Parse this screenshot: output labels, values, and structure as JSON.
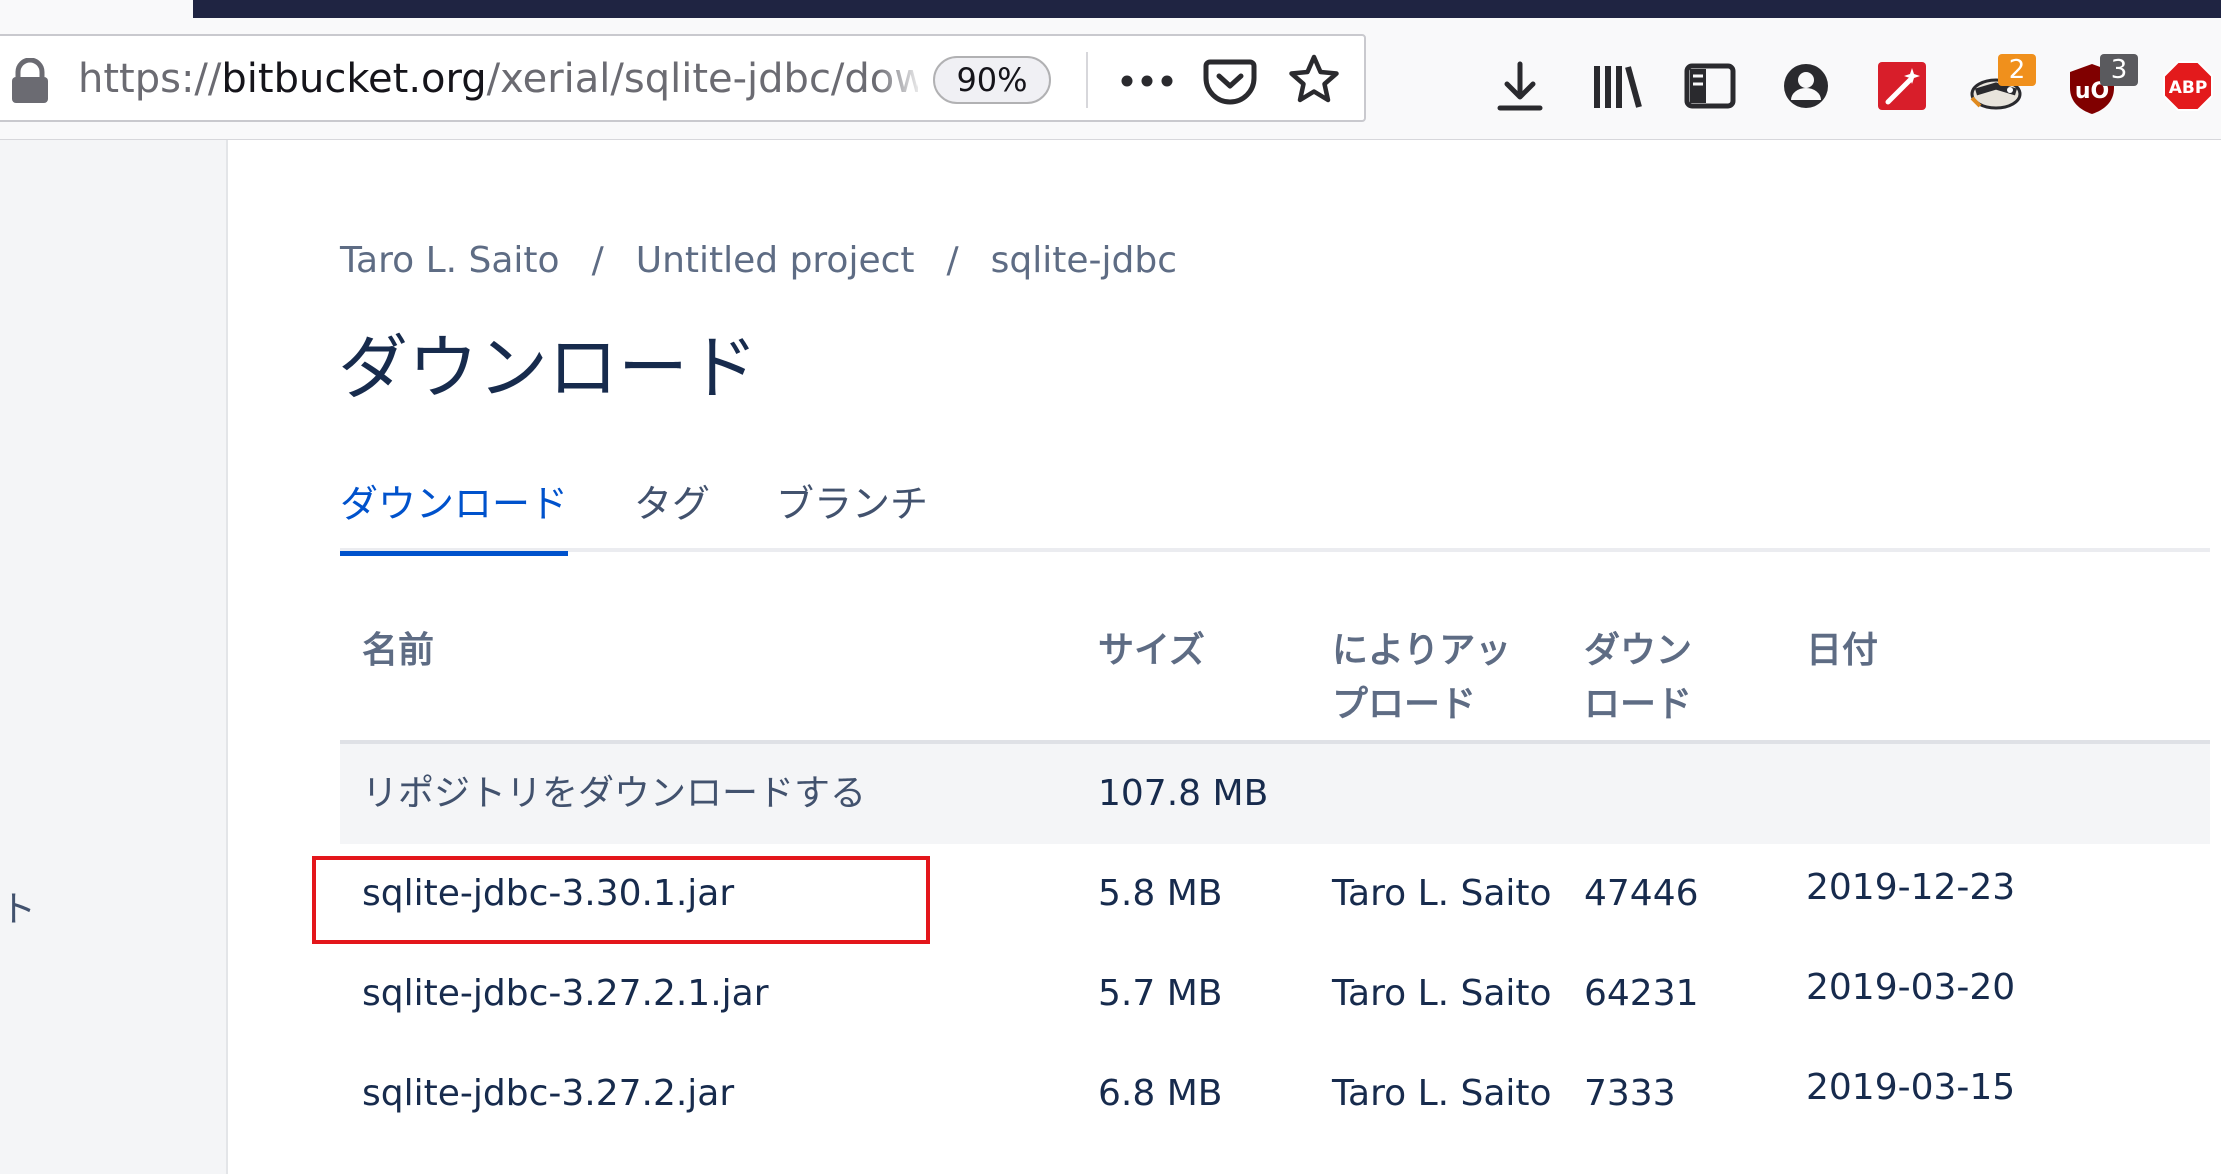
{
  "browser": {
    "url_prefix": "https://",
    "url_host": "bitbucket.org",
    "url_path": "/xerial/sqlite-jdbc/downl",
    "zoom": "90%",
    "extensions": {
      "redirector_badge": "2",
      "ublock_badge": "3",
      "adblock_label": "ABP"
    },
    "colors": {
      "chrome_dark": "#1f2442",
      "toolbar": "#f9f9fa"
    }
  },
  "sidebar": {
    "fragment": "ト"
  },
  "breadcrumb": [
    "Taro L. Saito",
    "Untitled project",
    "sqlite-jdbc"
  ],
  "breadcrumb_sep": "/",
  "page": {
    "title": "ダウンロード"
  },
  "tabs": [
    {
      "label": "ダウンロード",
      "active": true
    },
    {
      "label": "タグ",
      "active": false
    },
    {
      "label": "ブランチ",
      "active": false
    }
  ],
  "table": {
    "headers": {
      "name": "名前",
      "size": "サイズ",
      "uploader_line1": "によりアッ",
      "uploader_line2": "プロード",
      "downloads_line1": "ダウン",
      "downloads_line2": "ロード",
      "date": "日付"
    },
    "repo_row": {
      "name": "リポジトリをダウンロードする",
      "size": "107.8 MB"
    },
    "rows": [
      {
        "name": "sqlite-jdbc-3.30.1.jar",
        "size": "5.8 MB",
        "uploader": "Taro L. Saito",
        "downloads": "47446",
        "date": "2019-12-23"
      },
      {
        "name": "sqlite-jdbc-3.27.2.1.jar",
        "size": "5.7 MB",
        "uploader": "Taro L. Saito",
        "downloads": "64231",
        "date": "2019-03-20"
      },
      {
        "name": "sqlite-jdbc-3.27.2.jar",
        "size": "6.8 MB",
        "uploader": "Taro L. Saito",
        "downloads": "7333",
        "date": "2019-03-15"
      }
    ]
  },
  "colors": {
    "accent": "#0052cc",
    "highlight": "#e3161b",
    "text": "#172b4d",
    "muted": "#5e6c84"
  }
}
